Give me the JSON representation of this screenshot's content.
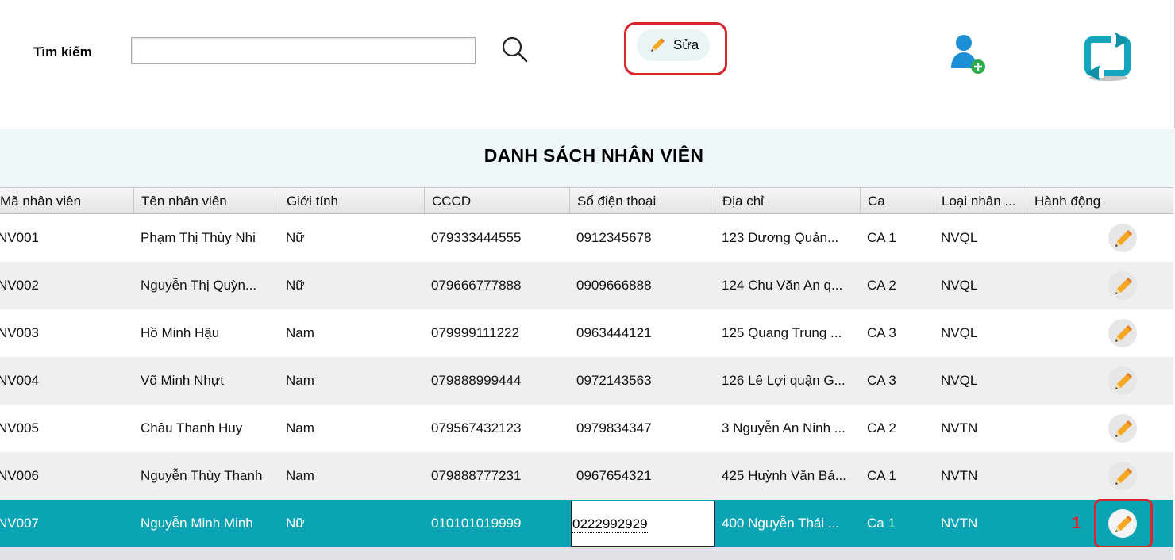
{
  "search": {
    "label": "Tìm kiếm",
    "value": "",
    "placeholder": ""
  },
  "toolbar": {
    "edit_label": "Sửa",
    "icons": [
      "search-icon",
      "pencil-icon",
      "add-user-icon",
      "refresh-icon"
    ]
  },
  "page_title": "DANH SÁCH NHÂN VIÊN",
  "table": {
    "columns": [
      "Mã nhân viên",
      "Tên nhân viên",
      "Giới tính",
      "CCCD",
      "Số điện thoại",
      "Địa chỉ",
      "Ca",
      "Loại nhân ...",
      "Hành động"
    ],
    "rows": [
      [
        "NV001",
        "Phạm Thị Thùy Nhi",
        "Nữ",
        "079333444555",
        "0912345678",
        "123 Dương Quản...",
        "CA 1",
        "NVQL"
      ],
      [
        "NV002",
        "Nguyễn Thị Quỳn...",
        "Nữ",
        "079666777888",
        "0909666888",
        "124 Chu Văn An q...",
        "CA 2",
        "NVQL"
      ],
      [
        "NV003",
        "Hồ Minh Hậu",
        "Nam",
        "079999111222",
        "0963444121",
        "125 Quang Trung ...",
        "CA 3",
        "NVQL"
      ],
      [
        "NV004",
        "Võ Minh Nhựt",
        "Nam",
        "079888999444",
        "0972143563",
        "126 Lê Lợi quận G...",
        "CA 3",
        "NVQL"
      ],
      [
        "NV005",
        "Châu Thanh Huy",
        "Nam",
        "079567432123",
        "0979834347",
        "3 Nguyễn An Ninh ...",
        "CA 2",
        "NVTN"
      ],
      [
        "NV006",
        "Nguyễn Thùy Thanh",
        "Nam",
        "079888777231",
        "0967654321",
        "425 Huỳnh Văn Bá...",
        "CA 1",
        "NVTN"
      ],
      [
        "NV007",
        "Nguyễn Minh Minh",
        "Nữ",
        "010101019999",
        "",
        "400 Nguyễn Thái ...",
        "Ca 1",
        "NVTN"
      ]
    ],
    "editing_phone_value": "0222992929",
    "selected_row_index": 6
  },
  "annotation": {
    "step_label": "1"
  },
  "colors": {
    "selected_row": "#0aa4b4",
    "highlight": "#d9262e",
    "title_band": "#eef8f8",
    "alt_row": "#efefef"
  }
}
